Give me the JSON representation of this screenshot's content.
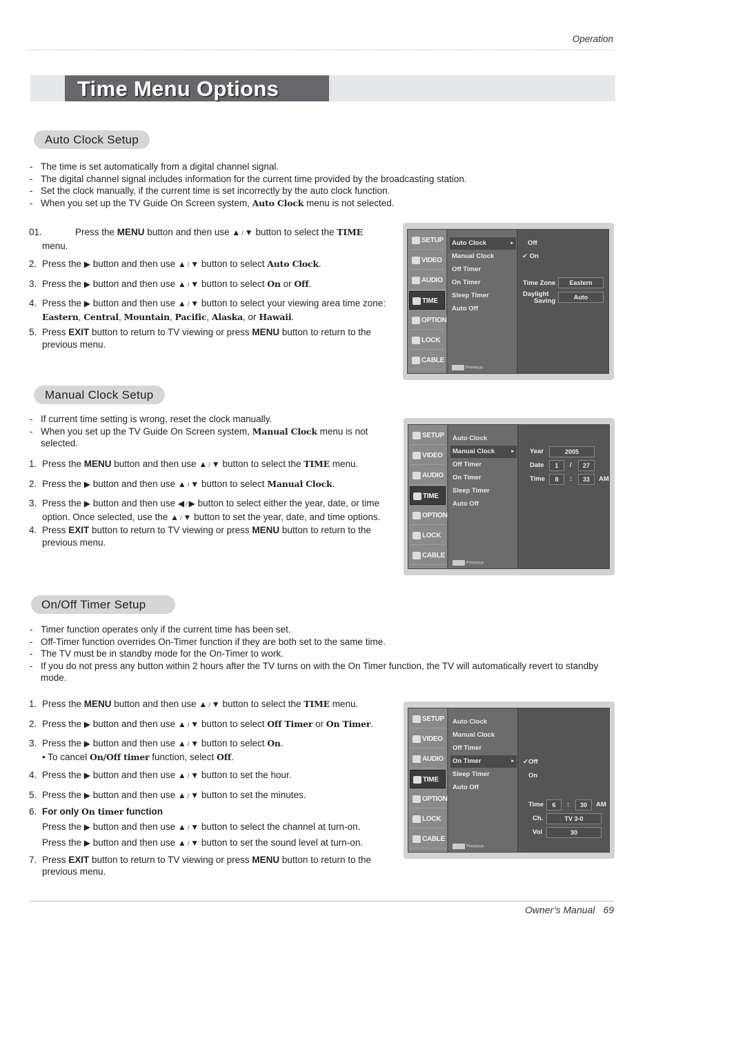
{
  "header": {
    "section": "Operation"
  },
  "title": "Time Menu Options",
  "auto_clock": {
    "heading": "Auto Clock Setup",
    "bullets": [
      "The time is set automatically from a digital channel signal.",
      "The digital channel signal includes information for the current time provided by the broadcasting station.",
      "Set the clock manually, if the current time is set incorrectly by the auto clock function.",
      [
        "When you set up the TV Guide On Screen system, ",
        "Auto Clock",
        " menu is not selected."
      ]
    ],
    "steps": {
      "s1": {
        "num": "01.",
        "a": "Press the ",
        "b": "MENU",
        "c": " button and then use ",
        "d": " button to select the ",
        "e": "TIME",
        "f": "menu."
      },
      "s2": {
        "num": "2.",
        "a": "Press the ",
        "b": " button and then use ",
        "c": " button to select ",
        "d": "Auto Clock",
        "e": "."
      },
      "s3": {
        "num": "3.",
        "a": "Press the ",
        "b": " button and then use ",
        "c": " button to select ",
        "d": "On",
        "e": " or ",
        "f": "Off",
        "g": "."
      },
      "s4": {
        "num": "4.",
        "a": "Press the ",
        "b": " button and then use ",
        "c": " button to select your viewing area time zone: ",
        "z1": "Eastern",
        "z2": "Central",
        "z3": "Mountain",
        "z4": "Pacific",
        "z5": "Alaska",
        "or": ", or ",
        "z6": "Hawaii",
        "sep": ", ",
        "end": "."
      },
      "s5": {
        "num": "5.",
        "a": "Press ",
        "b": "EXIT",
        "c": " button to return to TV viewing or press ",
        "d": "MENU",
        "e": " button to return to the previous menu."
      }
    },
    "screen": {
      "side": [
        "SETUP",
        "VIDEO",
        "AUDIO",
        "TIME",
        "OPTION",
        "LOCK",
        "CABLE"
      ],
      "selected_side": "TIME",
      "menu": [
        "Auto Clock",
        "Manual Clock",
        "Off Timer",
        "On Timer",
        "Sleep Timer",
        "Auto Off"
      ],
      "selected_menu": "Auto Clock",
      "options": [
        "Off",
        "On"
      ],
      "checked_option": "On",
      "time_zone_label": "Time Zone",
      "time_zone_value": "Eastern",
      "daylight_label_1": "Daylight",
      "daylight_label_2": "Saving",
      "daylight_value": "Auto",
      "previous": "Previous",
      "menu_key": "MENU"
    }
  },
  "manual_clock": {
    "heading": "Manual Clock Setup",
    "bullets": [
      "If current time setting is wrong, reset the clock manually.",
      [
        "When you set up the TV Guide On Screen system, ",
        "Manual Clock",
        " menu is not selected."
      ]
    ],
    "steps": {
      "s1": {
        "num": "1.",
        "a": "Press the ",
        "b": "MENU",
        "c": " button and then use ",
        "d": " button to select the ",
        "e": "TIME",
        "f": " menu."
      },
      "s2": {
        "num": "2.",
        "a": "Press the ",
        "b": " button and then use ",
        "c": " button to select ",
        "d": "Manual Clock",
        "e": "."
      },
      "s3": {
        "num": "3.",
        "a": "Press the ",
        "b": " button and then use ",
        "c": " button to select either the year, date, or time option. Once selected, use the ",
        "d": " button to set the year, date, and time options."
      },
      "s4": {
        "num": "4.",
        "a": "Press ",
        "b": "EXIT",
        "c": " button to return to TV viewing or press ",
        "d": "MENU",
        "e": " button to return to the previous menu."
      }
    },
    "screen": {
      "side": [
        "SETUP",
        "VIDEO",
        "AUDIO",
        "TIME",
        "OPTION",
        "LOCK",
        "CABLE"
      ],
      "selected_side": "TIME",
      "menu": [
        "Auto Clock",
        "Manual Clock",
        "Off Timer",
        "On Timer",
        "Sleep Timer",
        "Auto Off"
      ],
      "selected_menu": "Manual Clock",
      "year_label": "Year",
      "year_value": "2005",
      "date_label": "Date",
      "date_month": "1",
      "date_sep": "/",
      "date_day": "27",
      "time_label": "Time",
      "time_hour": "8",
      "time_sep": ":",
      "time_min": "33",
      "time_ampm": "AM",
      "previous": "Previous",
      "menu_key": "MENU"
    }
  },
  "timer": {
    "heading": "On/Off Timer Setup",
    "bullets": [
      "Timer function operates only if the current time has been set.",
      "Off-Timer function overrides On-Timer function if they are both set to the same time.",
      "The TV must be in standby mode for the On-Timer to work.",
      "If you do not press any button within 2 hours after the TV turns on with the On Timer function, the TV will automatically revert to standby mode."
    ],
    "steps": {
      "s1": {
        "num": "1.",
        "a": "Press the ",
        "b": "MENU",
        "c": " button and then use ",
        "d": " button to select the ",
        "e": "TIME",
        "f": " menu."
      },
      "s2": {
        "num": "2.",
        "a": "Press the ",
        "b": " button and then use ",
        "c": " button to select ",
        "d": "Off Timer",
        "e": " or ",
        "f": "On Timer",
        "g": "."
      },
      "s3": {
        "num": "3.",
        "a": "Press the ",
        "b": " button and then use ",
        "c": " button to select ",
        "d": "On",
        "e": ".",
        "note_a": "• To cancel ",
        "note_b": "On/Off timer",
        "note_c": " function, select ",
        "note_d": "Off",
        "note_e": "."
      },
      "s4": {
        "num": "4.",
        "a": "Press the ",
        "b": " button and then use ",
        "c": " button to set the hour."
      },
      "s5": {
        "num": "5.",
        "a": "Press the ",
        "b": " button and then use ",
        "c": " button to set the minutes."
      },
      "s6": {
        "num": "6.",
        "a": "For only ",
        "b": "On timer",
        "c": " function",
        "l1a": "Press the ",
        "l1b": " button and then use ",
        "l1c": " button to select the channel at turn-on.",
        "l2a": "Press the ",
        "l2b": " button and then use ",
        "l2c": " button to set the sound level at turn-on."
      },
      "s7": {
        "num": "7.",
        "a": "Press ",
        "b": "EXIT",
        "c": " button to return to TV viewing or press ",
        "d": "MENU",
        "e": " button to return to the previous menu."
      }
    },
    "screen": {
      "side": [
        "SETUP",
        "VIDEO",
        "AUDIO",
        "TIME",
        "OPTION",
        "LOCK",
        "CABLE"
      ],
      "selected_side": "TIME",
      "menu": [
        "Auto Clock",
        "Manual Clock",
        "Off Timer",
        "On Timer",
        "Sleep Timer",
        "Auto Off"
      ],
      "selected_menu": "On Timer",
      "options": [
        "Off",
        "On"
      ],
      "checked_option": "Off",
      "time_label": "Time",
      "time_hour": "6",
      "time_sep": ":",
      "time_min": "30",
      "time_ampm": "AM",
      "ch_label": "Ch.",
      "ch_value": "TV 3-0",
      "vol_label": "Vol",
      "vol_value": "30",
      "previous": "Previous",
      "menu_key": "MENU"
    }
  },
  "glyphs": {
    "right": "▶",
    "left": "◀",
    "up": "▲",
    "down": "▼",
    "slash": "/",
    "check": "✓",
    "caret": "▸"
  },
  "footer": {
    "label": "Owner’s Manual",
    "page": "69"
  }
}
